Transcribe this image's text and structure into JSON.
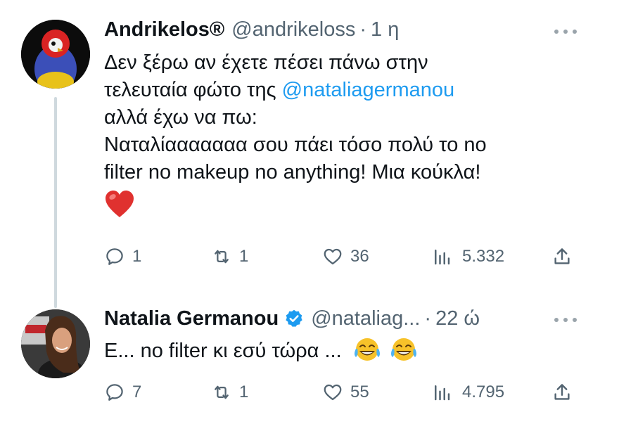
{
  "colors": {
    "link": "#1d9bf0",
    "secondary_text": "#536471",
    "verified_badge": "#1d9bf0",
    "thread_line": "#cfd9de"
  },
  "tweets": [
    {
      "display_name": "Andrikelos®",
      "handle": "@andrikeloss",
      "separator": "·",
      "time": "1 η",
      "text_lines": [
        {
          "before": "Δεν ξέρω αν έχετε πέσει πάνω στην",
          "mention": "",
          "after": ""
        },
        {
          "before": "τελευταία φώτο της ",
          "mention": "@nataliagermanou",
          "after": ""
        },
        {
          "before": "αλλά έχω να πω:",
          "mention": "",
          "after": ""
        },
        {
          "before": "Ναταλίααααααα σου πάει τόσο πολύ το no",
          "mention": "",
          "after": ""
        },
        {
          "before": "filter no makeup no anything! Μια κούκλα!",
          "mention": "",
          "after": ""
        }
      ],
      "emoji": "heart",
      "stats": {
        "replies": "1",
        "retweets": "1",
        "likes": "36",
        "views": "5.332"
      }
    },
    {
      "display_name": "Natalia Germanou",
      "verified": true,
      "handle": "@nataliag...",
      "separator": "·",
      "time": "22 ώ",
      "text": "Ε... no filter κι εσύ τώρα ...",
      "emoji": "tears-of-joy x2",
      "stats": {
        "replies": "7",
        "retweets": "1",
        "likes": "55",
        "views": "4.795"
      }
    }
  ]
}
